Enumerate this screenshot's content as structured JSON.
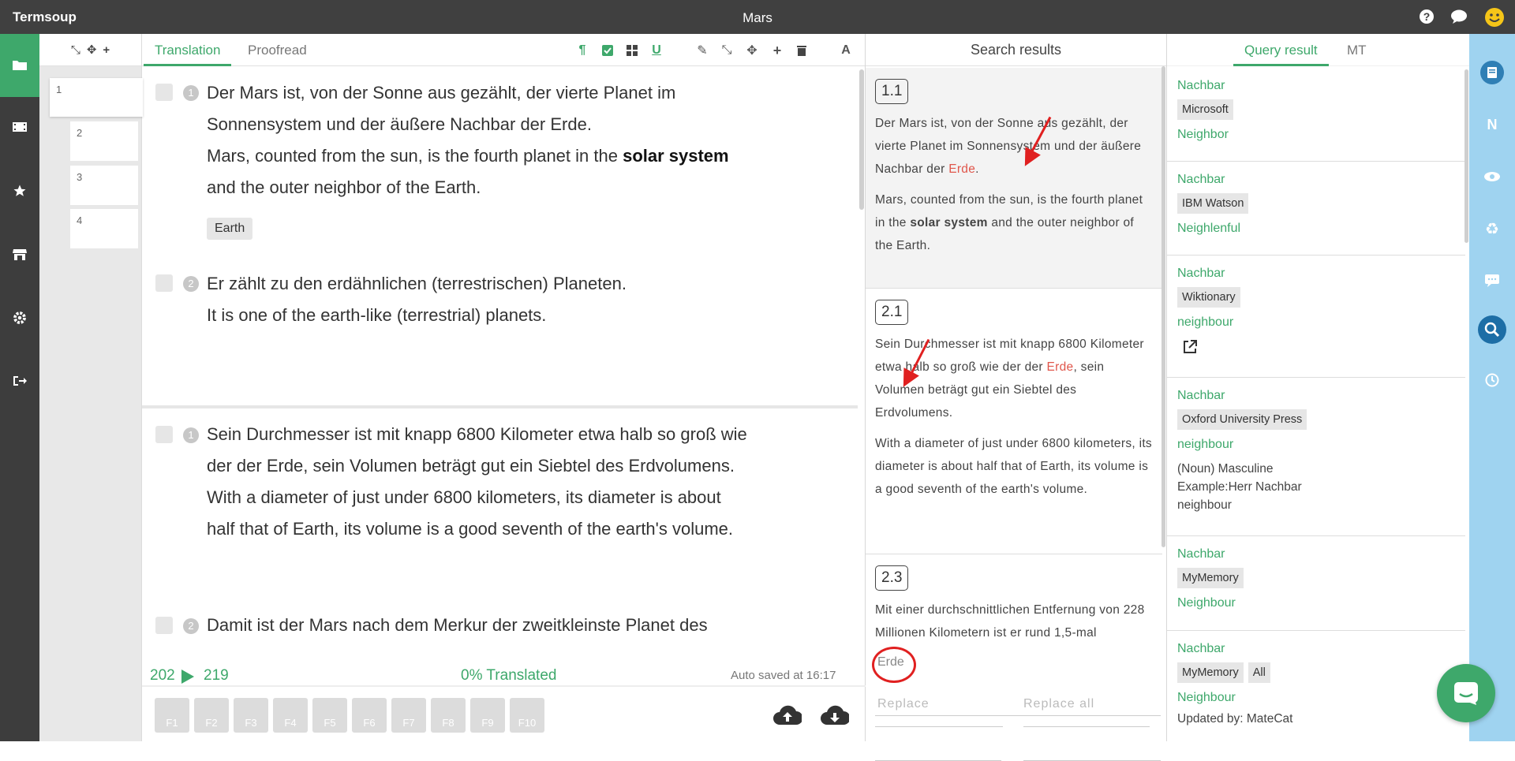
{
  "app": {
    "name": "Termsoup",
    "document_title": "Mars"
  },
  "left_rail": {
    "items": [
      "folder-icon",
      "film-icon",
      "star-icon",
      "store-icon",
      "gear-icon",
      "sign-out-icon"
    ]
  },
  "segments": {
    "boxes": [
      "1",
      "2",
      "3",
      "4"
    ]
  },
  "tabs": {
    "translation": "Translation",
    "proofread": "Proofread"
  },
  "editor": {
    "block1": {
      "s1_num": "1",
      "s1_source_a": "Der Mars ist, von der Sonne aus gezählt, der vierte Planet im",
      "s1_source_b": "Sonnensystem und der äußere Nachbar der Erde.",
      "s1_target_a": "Mars, counted from the sun, is the fourth planet in the ",
      "s1_target_bold": "solar system",
      "s1_target_b": "and the outer neighbor of the Earth.",
      "s1_chip": "Earth",
      "s2_num": "2",
      "s2_source": "Er zählt zu den erdähnlichen (terrestrischen) Planeten.",
      "s2_target": "It is one of the earth-like (terrestrial) planets."
    },
    "block2": {
      "s1_num": "1",
      "s1_source_a": "Sein Durchmesser ist mit knapp 6800 Kilometer etwa halb so groß wie",
      "s1_source_b": "der der Erde, sein Volumen beträgt gut ein Siebtel des Erdvolumens.",
      "s1_target_a": "With a diameter of just under 6800 kilometers, its diameter is about",
      "s1_target_b": "half that of Earth, its volume is a good seventh of the earth's volume.",
      "s2_num": "2",
      "s2_source": "Damit ist der Mars nach dem Merkur der zweitkleinste Planet des"
    }
  },
  "footer": {
    "count_from": "202",
    "count_to": "219",
    "translated": "0% Translated",
    "autosave": "Auto saved at 16:17",
    "fkeys": [
      "F1",
      "F2",
      "F3",
      "F4",
      "F5",
      "F6",
      "F7",
      "F8",
      "F9",
      "F10"
    ]
  },
  "search": {
    "title": "Search results",
    "results": [
      {
        "id": "1.1",
        "src_a": "Der Mars ist, von der Sonne aus gezählt, der vierte Planet im Sonnensystem und der äußere Nachbar der ",
        "hit": "Erde",
        "src_b": ".",
        "tgt_a": "Mars, counted from the sun, is the fourth planet in the ",
        "tgt_bold": "solar system",
        "tgt_b": " and the outer neighbor of the Earth."
      },
      {
        "id": "2.1",
        "src_a": "Sein Durchmesser ist mit knapp 6800 Kilometer etwa halb so groß wie der der ",
        "hit": "Erde",
        "src_b": ", sein Volumen beträgt gut ein Siebtel des Erdvolumens.",
        "tgt": "With a diameter of just under 6800 kilometers, its diameter is about half that of Earth, its volume is a good seventh of the earth's volume."
      },
      {
        "id": "2.3",
        "src": "Mit einer durchschnittlichen Entfernung von 228 Millionen Kilometern ist er rund 1,5-mal"
      }
    ],
    "query_value": "Erde",
    "replace_placeholder": "Replace",
    "replace_all_placeholder": "Replace all"
  },
  "query": {
    "tabs": {
      "query_result": "Query result",
      "mt": "MT"
    },
    "entries": [
      {
        "source": "Nachbar",
        "provider": "Microsoft",
        "target": "Neighbor"
      },
      {
        "source": "Nachbar",
        "provider": "IBM Watson",
        "target": "Neighlenful"
      },
      {
        "source": "Nachbar",
        "provider": "Wiktionary",
        "target": "neighbour"
      },
      {
        "source": "Nachbar",
        "provider": "Oxford University Press",
        "target": "neighbour",
        "note1": "(Noun) Masculine",
        "note2": "Example:Herr Nachbar",
        "note3": "neighbour"
      },
      {
        "source": "Nachbar",
        "provider": "MyMemory",
        "target": "Neighbour"
      },
      {
        "source": "Nachbar",
        "provider": "MyMemory",
        "provider2": "All",
        "target": "Neighbour",
        "updated": "Updated by: MateCat"
      }
    ]
  },
  "colors": {
    "accent": "#3ea86b",
    "dark": "#404040",
    "right_rail": "#9fd3f0",
    "hit": "#e0564b"
  }
}
